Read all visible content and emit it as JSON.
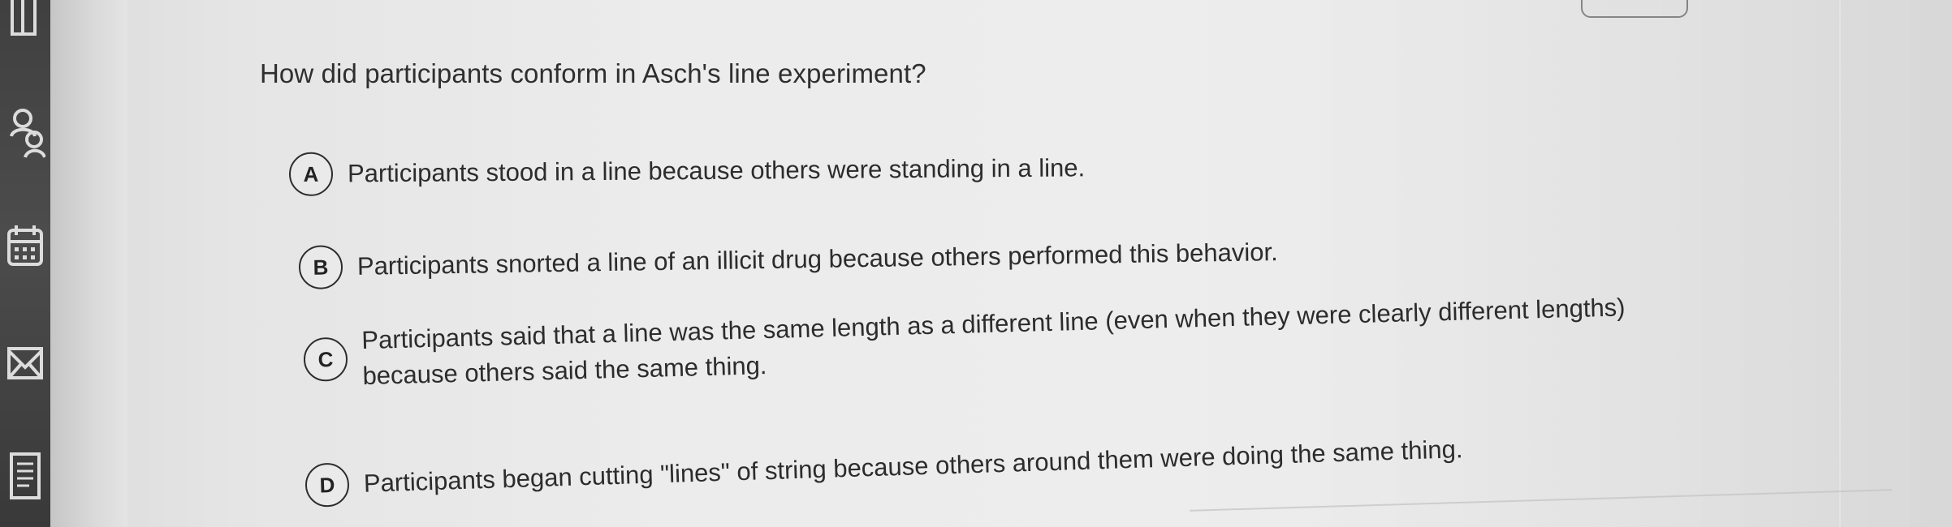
{
  "question": "How did participants conform in Asch's line experiment?",
  "options": [
    {
      "letter": "A",
      "text": "Participants stood in a line because others were standing in a line."
    },
    {
      "letter": "B",
      "text": "Participants snorted a line of an illicit drug because others performed this behavior."
    },
    {
      "letter": "C",
      "text": "Participants said that a line was the same length as a different line (even when they were clearly different lengths) because others said the same thing."
    },
    {
      "letter": "D",
      "text": "Participants began cutting \"lines\" of string because others around them were doing the same thing."
    }
  ],
  "sidebar": {
    "icons": [
      "panel-icon",
      "people-icon",
      "calendar-icon",
      "envelope-icon",
      "document-icon"
    ]
  },
  "colors": {
    "background": "#e8e8e8",
    "sidebar": "#424242",
    "text": "#2c2c2c"
  }
}
